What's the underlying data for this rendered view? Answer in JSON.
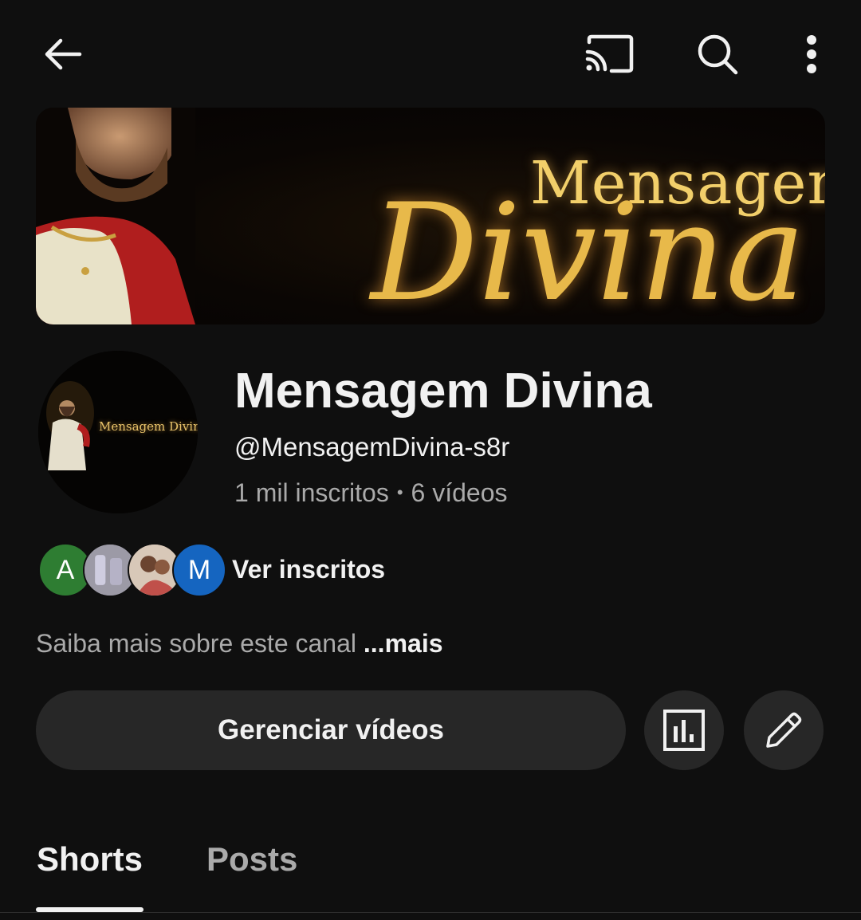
{
  "topbar": {
    "back_icon": "arrow-left-icon",
    "cast_icon": "cast-icon",
    "search_icon": "search-icon",
    "more_icon": "more-vertical-icon"
  },
  "banner": {
    "line1": "Mensagem",
    "line2": "Divina"
  },
  "channel": {
    "avatar_text": "Mensagem Divina",
    "name": "Mensagem Divina",
    "handle": "@MensagemDivina-s8r",
    "subscribers": "1 mil inscritos",
    "separator": "•",
    "videos": "6 vídeos"
  },
  "subscribers_preview": {
    "avatars": [
      {
        "letter": "A",
        "color": "#2e7d32"
      },
      {
        "letter": "",
        "color": "#8a8896"
      },
      {
        "letter": "",
        "color": "#a08070"
      },
      {
        "letter": "M",
        "color": "#1565c0"
      }
    ],
    "label": "Ver inscritos"
  },
  "about": {
    "text": "Saiba mais sobre este canal",
    "more": "...mais"
  },
  "actions": {
    "manage_label": "Gerenciar vídeos",
    "stats_icon": "analytics-icon",
    "edit_icon": "pencil-icon"
  },
  "tabs": [
    {
      "label": "Shorts",
      "active": true
    },
    {
      "label": "Posts",
      "active": false
    }
  ],
  "colors": {
    "background": "#0f0f0f",
    "button_bg": "#272727",
    "text_primary": "#f1f1f1",
    "text_secondary": "#aaaaaa",
    "banner_gold": "#e8b94a"
  }
}
